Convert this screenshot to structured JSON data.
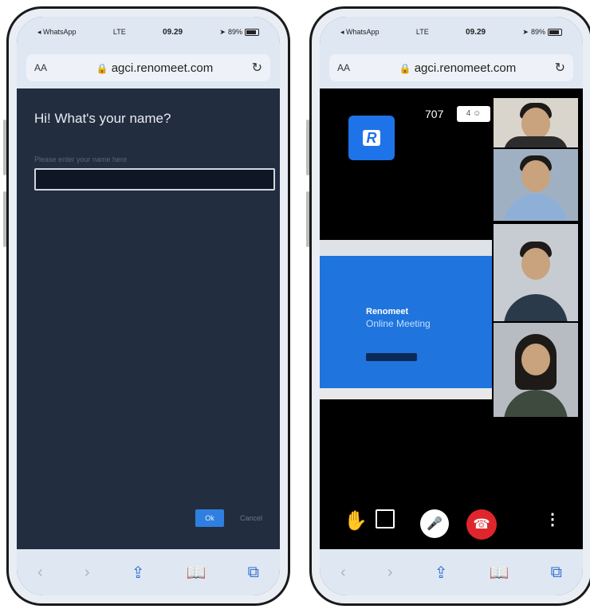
{
  "status_bar": {
    "carrier": "◂ WhatsApp",
    "network": "LTE",
    "time": "09.29",
    "battery": "89%"
  },
  "browser": {
    "aa_label": "AA",
    "url": "agci.renomeet.com",
    "lock_icon": "lock-icon",
    "reload_icon": "reload-icon"
  },
  "left_screen": {
    "title": "Hi! What's your name?",
    "name_placeholder": "Please enter your name here",
    "name_value": "",
    "ok_label": "Ok",
    "cancel_label": "Cancel"
  },
  "right_screen": {
    "logo_letter": "R",
    "room_code": "707",
    "participant_count": "4",
    "shared_heading": "Renomeet",
    "shared_subheading": "Online Meeting",
    "controls": [
      "raise-hand-icon",
      "chat-icon",
      "mic-icon",
      "hangup-icon",
      "more-icon"
    ]
  },
  "toolbar_icons": [
    "back-icon",
    "forward-icon",
    "share-icon",
    "bookmarks-icon",
    "tabs-icon"
  ],
  "colors": {
    "dark_bg": "#232d40",
    "accent": "#2f7fe0",
    "hangup": "#e0262d",
    "brand_blue": "#1f73e8"
  }
}
